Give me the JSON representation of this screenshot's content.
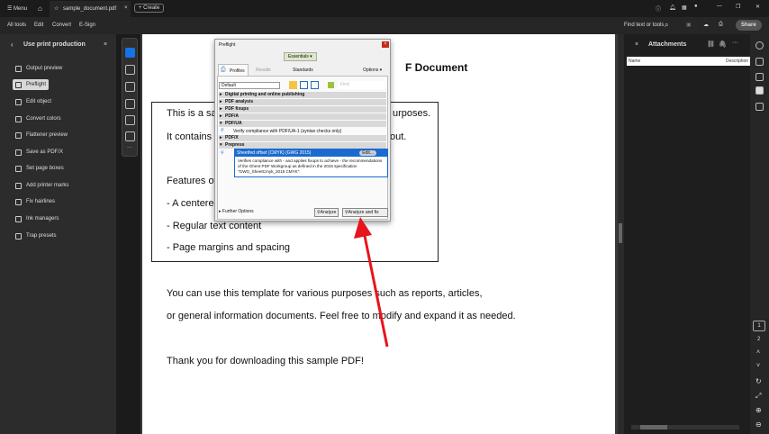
{
  "topbar": {
    "menu": "Menu",
    "tab": "sample_document.pdf",
    "create": "Create"
  },
  "menubar": {
    "items": [
      "All tools",
      "Edit",
      "Convert",
      "E-Sign"
    ],
    "find": "Find text or tools",
    "share": "Share"
  },
  "leftpanel": {
    "title": "Use print production",
    "items": [
      "Output preview",
      "Preflight",
      "Edit object",
      "Convert colors",
      "Flattener preview",
      "Save as PDF/X",
      "Set page boxes",
      "Add printer marks",
      "Fix hairlines",
      "Ink managers",
      "Trap presets"
    ]
  },
  "document": {
    "title_fragment": "F Document",
    "lines": [
      "This is a sa",
      "urposes.",
      "It contains s",
      "out.",
      "Features of",
      "- A centere",
      "- Regular text content",
      "- Page margins and spacing",
      "You can use this template for various purposes such as reports, articles,",
      "or general information documents. Feel free to modify and expand it as needed.",
      "Thank you for downloading this sample PDF!"
    ]
  },
  "dialog": {
    "title": "Preflight",
    "essentials": "Essentials ▾",
    "tabs": [
      "Profiles",
      "Results",
      "Standards"
    ],
    "options": "Options ▾",
    "profile_select": "Default",
    "find_placeholder": "Find",
    "categories": [
      "Digital printing and online publishing",
      "PDF analysis",
      "PDF fixups",
      "PDF/A",
      "PDF/UA",
      "PDF/X",
      "Prepress"
    ],
    "uaitem": "Verify compliance with PDF/UA-1 (syntax checks only)",
    "selected": "Sheetfed offset (CMYK) (GWG 2015)",
    "edit": "Edit...",
    "description": "Verifies compliance with - and applies fixups to achieve - the recommendations of the Ghent PDF Workgroup as defined in the 2015 specification \"GWG_SheetCmyk_2015 CMYK\".",
    "further": "Further Options",
    "analyze": "Analyze",
    "analyze_fix": "Analyze and fix"
  },
  "rightpanel": {
    "title": "Attachments",
    "col_name": "Name",
    "col_desc": "Description"
  },
  "pages": [
    "1",
    "2"
  ],
  "colors": {
    "accent": "#1473e6",
    "arrow": "#e8141c"
  }
}
